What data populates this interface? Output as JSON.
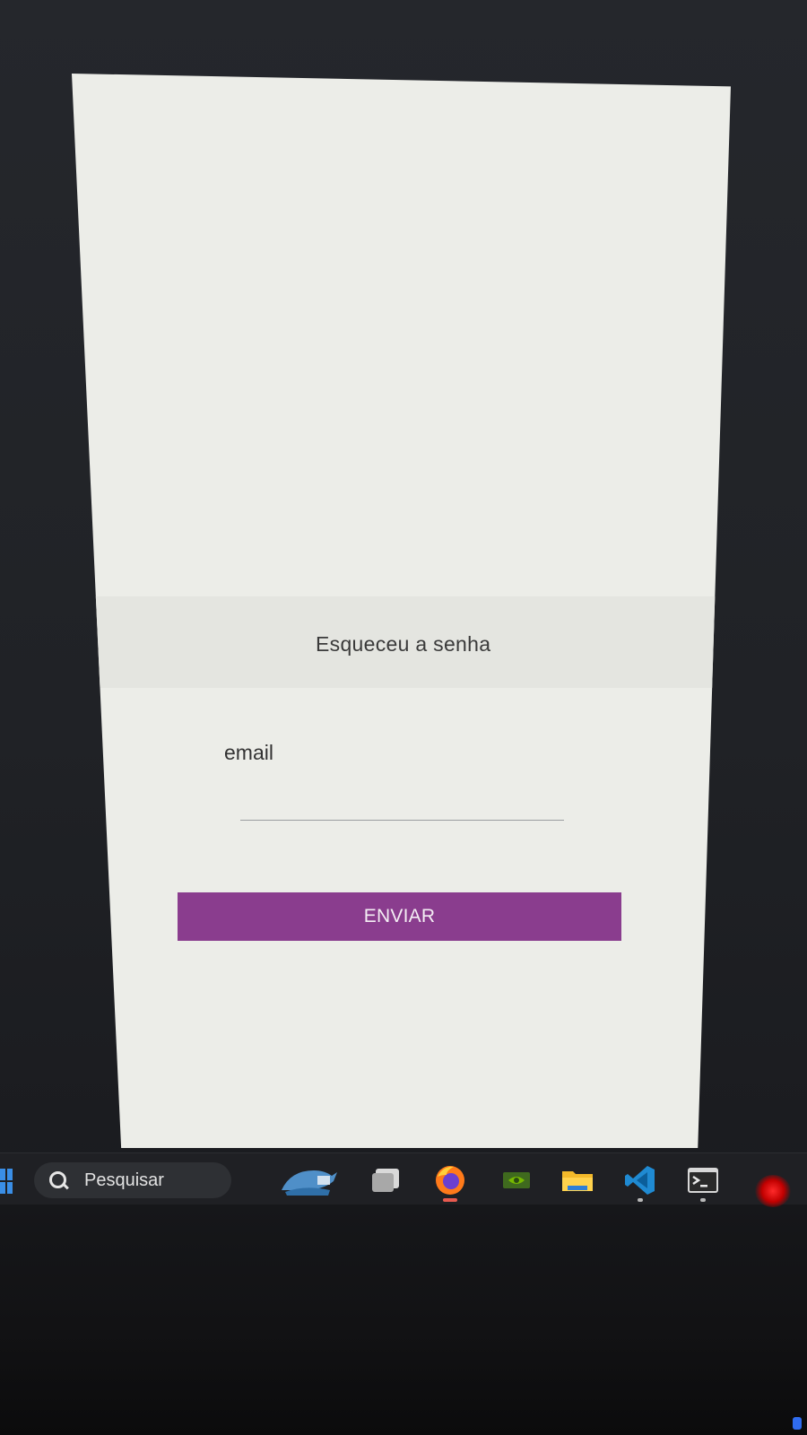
{
  "app": {
    "title": "Esqueceu a senha",
    "field_label": "email",
    "email_value": "",
    "email_placeholder": "",
    "submit_label": "ENVIAR",
    "accent_color": "#8a3d8e"
  },
  "taskbar": {
    "search_label": "Pesquisar",
    "apps": [
      {
        "icon": "mysql-workbench-icon",
        "running": false
      },
      {
        "icon": "app-window-icon",
        "running": false
      },
      {
        "icon": "firefox-icon",
        "running": true
      },
      {
        "icon": "nvidia-icon",
        "running": false
      },
      {
        "icon": "file-explorer-icon",
        "running": false
      },
      {
        "icon": "vscode-icon",
        "running": true
      },
      {
        "icon": "terminal-icon",
        "running": true
      }
    ]
  }
}
